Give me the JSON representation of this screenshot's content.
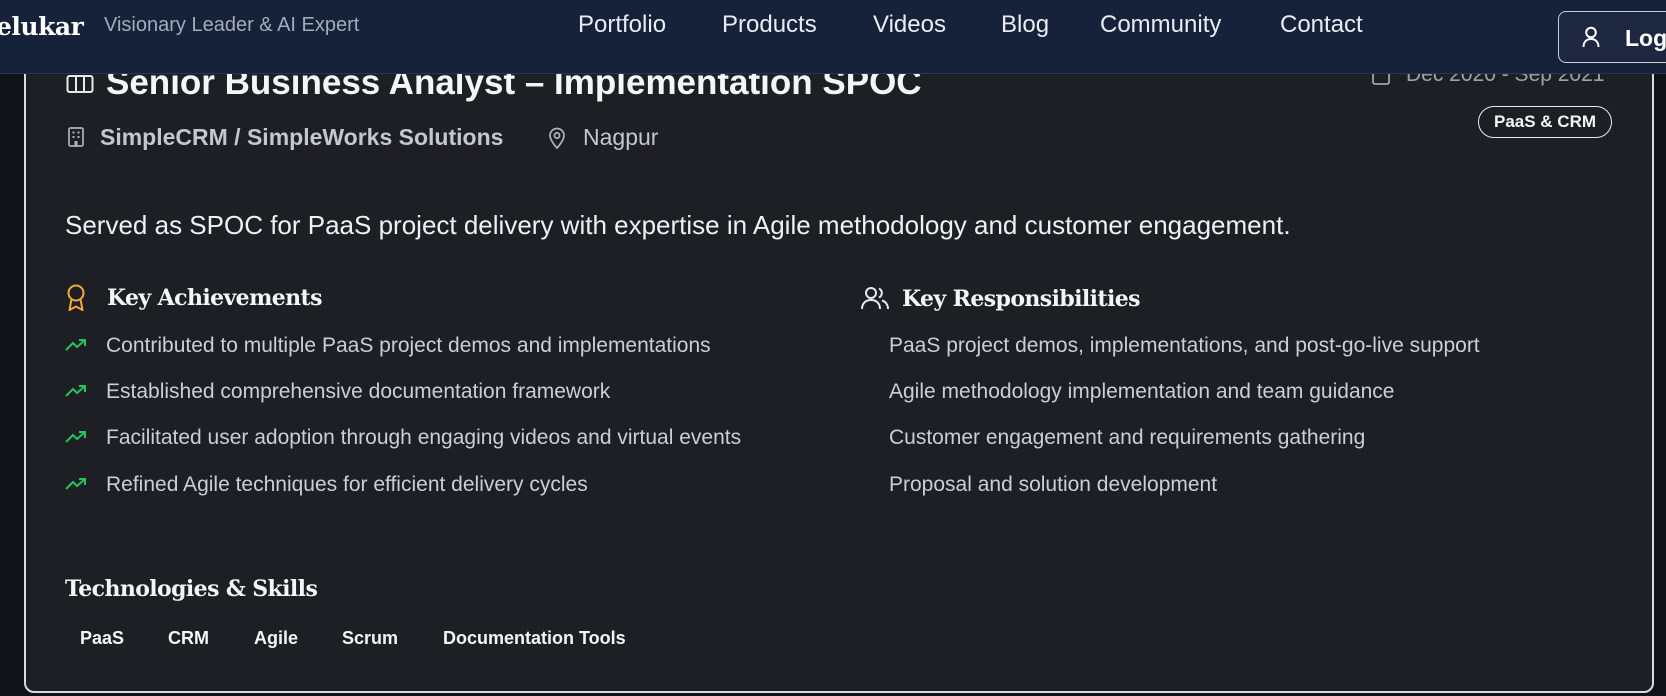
{
  "nav": {
    "brand": "elukar",
    "tagline": "Visionary Leader & AI Expert",
    "links": [
      "Portfolio",
      "Products",
      "Videos",
      "Blog",
      "Community",
      "Contact"
    ],
    "login_label": "Logi"
  },
  "job": {
    "title": "Senior Business Analyst – Implementation SPOC",
    "dates": "Dec 2020 - Sep 2021",
    "category_badge": "PaaS & CRM",
    "company": "SimpleCRM / SimpleWorks Solutions",
    "location": "Nagpur",
    "summary": "Served as SPOC for PaaS project delivery with expertise in Agile methodology and customer engagement."
  },
  "achievements": {
    "title": "Key Achievements",
    "items": [
      "Contributed to multiple PaaS project demos and implementations",
      "Established comprehensive documentation framework",
      "Facilitated user adoption through engaging videos and virtual events",
      "Refined Agile techniques for efficient delivery cycles"
    ]
  },
  "responsibilities": {
    "title": "Key Responsibilities",
    "items": [
      "PaaS project demos, implementations, and post-go-live support",
      "Agile methodology implementation and team guidance",
      "Customer engagement and requirements gathering",
      "Proposal and solution development"
    ]
  },
  "technologies": {
    "title": "Technologies & Skills",
    "tags": [
      "PaaS",
      "CRM",
      "Agile",
      "Scrum",
      "Documentation Tools"
    ]
  },
  "colors": {
    "nav_bg": "#16213a",
    "card_bg": "#1d1f24",
    "accent_award": "#f2a93b",
    "accent_trend": "#22c55e"
  },
  "icons": {
    "job": "columns-icon",
    "date": "calendar-icon",
    "company": "building-icon",
    "location": "map-pin-icon",
    "achievements": "award-icon",
    "responsibilities": "users-icon",
    "achievement_bullet": "trending-up-icon",
    "login": "user-icon"
  }
}
